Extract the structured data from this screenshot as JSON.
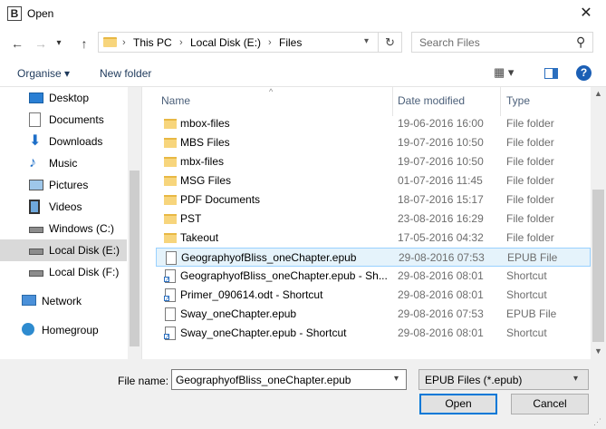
{
  "window": {
    "title": "Open",
    "app_glyph": "B",
    "close_glyph": "✕"
  },
  "nav": {
    "back": "←",
    "forward": "→",
    "recent": "▾",
    "up": "↑",
    "refresh": "↻",
    "dropdown": "▾",
    "chev": "›"
  },
  "breadcrumbs": [
    "This PC",
    "Local Disk (E:)",
    "Files"
  ],
  "search": {
    "placeholder": "Search Files",
    "icon": "⚲"
  },
  "toolbar": {
    "organise": "Organise ▾",
    "new_folder": "New folder",
    "view": "▦ ▾",
    "help": "?"
  },
  "sidebar": [
    {
      "label": "Desktop",
      "icon": "desktop-icon"
    },
    {
      "label": "Documents",
      "icon": "documents-icon"
    },
    {
      "label": "Downloads",
      "icon": "downloads-icon"
    },
    {
      "label": "Music",
      "icon": "music-icon"
    },
    {
      "label": "Pictures",
      "icon": "pictures-icon"
    },
    {
      "label": "Videos",
      "icon": "videos-icon"
    },
    {
      "label": "Windows (C:)",
      "icon": "drive-icon"
    },
    {
      "label": "Local Disk (E:)",
      "icon": "drive-icon",
      "selected": true
    },
    {
      "label": "Local Disk (F:)",
      "icon": "drive-icon"
    },
    {
      "label": "Network",
      "icon": "network-icon"
    },
    {
      "label": "Homegroup",
      "icon": "homegroup-icon"
    }
  ],
  "columns": {
    "name": "Name",
    "date": "Date modified",
    "type": "Type"
  },
  "files": [
    {
      "name": "mbox-files",
      "date": "19-06-2016 16:00",
      "type": "File folder",
      "kind": "folder"
    },
    {
      "name": "MBS Files",
      "date": "19-07-2016 10:50",
      "type": "File folder",
      "kind": "folder"
    },
    {
      "name": "mbx-files",
      "date": "19-07-2016 10:50",
      "type": "File folder",
      "kind": "folder"
    },
    {
      "name": "MSG Files",
      "date": "01-07-2016 11:45",
      "type": "File folder",
      "kind": "folder"
    },
    {
      "name": "PDF Documents",
      "date": "18-07-2016 15:17",
      "type": "File folder",
      "kind": "folder"
    },
    {
      "name": "PST",
      "date": "23-08-2016 16:29",
      "type": "File folder",
      "kind": "folder"
    },
    {
      "name": "Takeout",
      "date": "17-05-2016 04:32",
      "type": "File folder",
      "kind": "folder"
    },
    {
      "name": "GeographyofBliss_oneChapter.epub",
      "date": "29-08-2016 07:53",
      "type": "EPUB File",
      "kind": "doc",
      "selected": true
    },
    {
      "name": "GeographyofBliss_oneChapter.epub - Sh...",
      "date": "29-08-2016 08:01",
      "type": "Shortcut",
      "kind": "shortcut"
    },
    {
      "name": "Primer_090614.odt - Shortcut",
      "date": "29-08-2016 08:01",
      "type": "Shortcut",
      "kind": "shortcut"
    },
    {
      "name": "Sway_oneChapter.epub",
      "date": "29-08-2016 07:53",
      "type": "EPUB File",
      "kind": "doc"
    },
    {
      "name": "Sway_oneChapter.epub - Shortcut",
      "date": "29-08-2016 08:01",
      "type": "Shortcut",
      "kind": "shortcut"
    }
  ],
  "bottom": {
    "filename_label": "File name:",
    "filename_value": "GeographyofBliss_oneChapter.epub",
    "filetype_value": "EPUB Files (*.epub)",
    "open_label": "Open",
    "cancel_label": "Cancel",
    "dropdown": "▾"
  },
  "colors": {
    "accent": "#0078d7",
    "selection": "#e5f3fb",
    "folder": "#f7d57c"
  }
}
